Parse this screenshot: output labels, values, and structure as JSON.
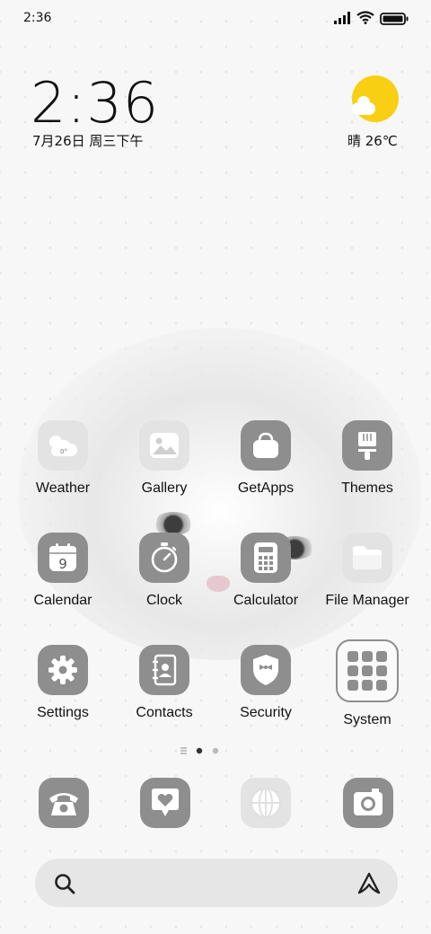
{
  "status_bar": {
    "time": "2:36",
    "signal_icon": "signal-icon",
    "wifi_icon": "wifi-icon",
    "battery_icon": "battery-icon"
  },
  "clock_widget": {
    "time": "2:36",
    "date": "7月26日 周三下午"
  },
  "weather_widget": {
    "condition_temp": "晴 26℃",
    "icon": "sun-cloud-icon",
    "sun_color": "#f9cf13"
  },
  "apps": [
    {
      "label": "Weather",
      "icon": "weather-icon"
    },
    {
      "label": "Gallery",
      "icon": "gallery-icon"
    },
    {
      "label": "GetApps",
      "icon": "shopping-bag-icon"
    },
    {
      "label": "Themes",
      "icon": "paintbrush-icon"
    },
    {
      "label": "Calendar",
      "icon": "calendar-icon",
      "badge": "9"
    },
    {
      "label": "Clock",
      "icon": "stopwatch-icon"
    },
    {
      "label": "Calculator",
      "icon": "calculator-icon"
    },
    {
      "label": "File Manager",
      "icon": "folder-icon"
    },
    {
      "label": "Settings",
      "icon": "gear-icon"
    },
    {
      "label": "Contacts",
      "icon": "contacts-book-icon"
    },
    {
      "label": "Security",
      "icon": "shield-icon"
    },
    {
      "label": "System",
      "icon": "folder-grid-icon"
    }
  ],
  "weather_icon_text": "0°",
  "page_indicator": {
    "pages": 2,
    "current": 1
  },
  "dock": [
    {
      "icon": "phone-icon"
    },
    {
      "icon": "messages-heart-icon"
    },
    {
      "icon": "browser-globe-icon"
    },
    {
      "icon": "camera-icon"
    }
  ],
  "search_bar": {
    "search_icon": "search-icon",
    "assistant_icon": "assistant-icon"
  },
  "colors": {
    "icon_gray": "#8e8e8e",
    "icon_light": "#e3e3e3",
    "background": "#f7f7f7"
  }
}
